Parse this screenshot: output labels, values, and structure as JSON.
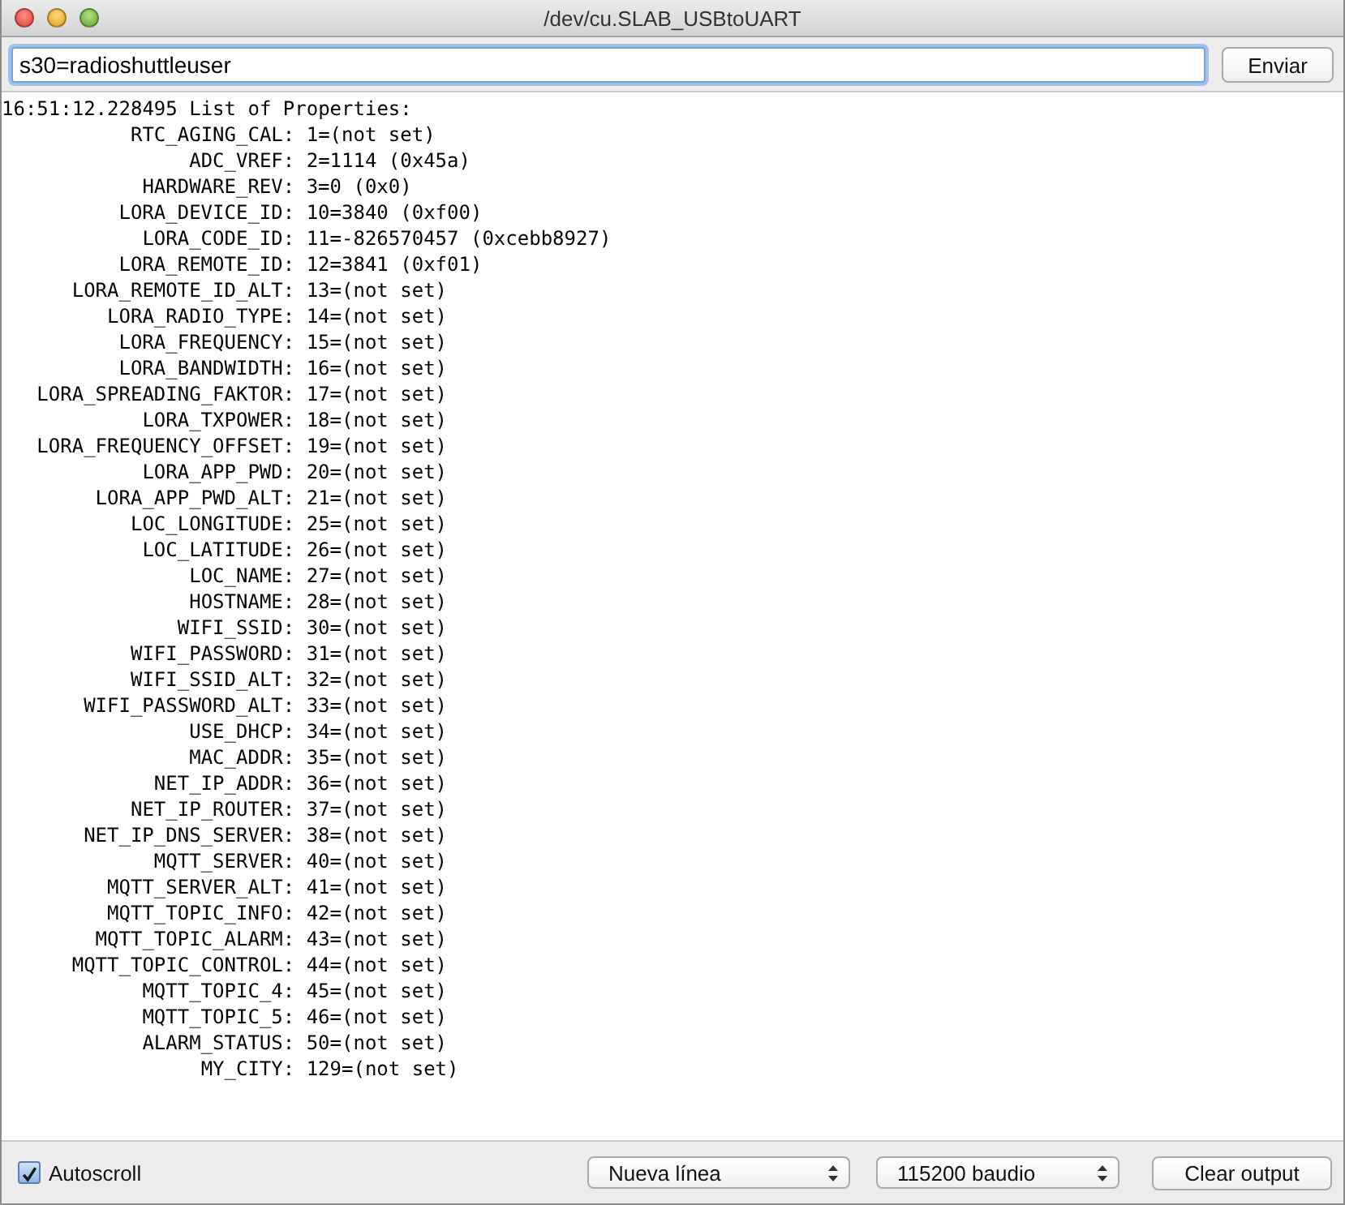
{
  "window": {
    "title": "/dev/cu.SLAB_USBtoUART"
  },
  "input": {
    "value": "s30=radioshuttleuser"
  },
  "send_button": "Enviar",
  "output": {
    "header": "16:51:12.228495 List of Properties:",
    "lines": [
      "RTC_AGING_CAL: 1=(not set)",
      "ADC_VREF: 2=1114 (0x45a)",
      "HARDWARE_REV: 3=0 (0x0)",
      "LORA_DEVICE_ID: 10=3840 (0xf00)",
      "LORA_CODE_ID: 11=-826570457 (0xcebb8927)",
      "LORA_REMOTE_ID: 12=3841 (0xf01)",
      "LORA_REMOTE_ID_ALT: 13=(not set)",
      "LORA_RADIO_TYPE: 14=(not set)",
      "LORA_FREQUENCY: 15=(not set)",
      "LORA_BANDWIDTH: 16=(not set)",
      "LORA_SPREADING_FAKTOR: 17=(not set)",
      "LORA_TXPOWER: 18=(not set)",
      "LORA_FREQUENCY_OFFSET: 19=(not set)",
      "LORA_APP_PWD: 20=(not set)",
      "LORA_APP_PWD_ALT: 21=(not set)",
      "LOC_LONGITUDE: 25=(not set)",
      "LOC_LATITUDE: 26=(not set)",
      "LOC_NAME: 27=(not set)",
      "HOSTNAME: 28=(not set)",
      "WIFI_SSID: 30=(not set)",
      "WIFI_PASSWORD: 31=(not set)",
      "WIFI_SSID_ALT: 32=(not set)",
      "WIFI_PASSWORD_ALT: 33=(not set)",
      "USE_DHCP: 34=(not set)",
      "MAC_ADDR: 35=(not set)",
      "NET_IP_ADDR: 36=(not set)",
      "NET_IP_ROUTER: 37=(not set)",
      "NET_IP_DNS_SERVER: 38=(not set)",
      "MQTT_SERVER: 40=(not set)",
      "MQTT_SERVER_ALT: 41=(not set)",
      "MQTT_TOPIC_INFO: 42=(not set)",
      "MQTT_TOPIC_ALARM: 43=(not set)",
      "MQTT_TOPIC_CONTROL: 44=(not set)",
      "MQTT_TOPIC_4: 45=(not set)",
      "MQTT_TOPIC_5: 46=(not set)",
      "ALARM_STATUS: 50=(not set)",
      "MY_CITY: 129=(not set)"
    ]
  },
  "footer": {
    "autoscroll": {
      "label": "Autoscroll",
      "checked": true
    },
    "line_ending": "Nueva línea",
    "baud_rate": "115200 baudio",
    "clear_button": "Clear output"
  }
}
